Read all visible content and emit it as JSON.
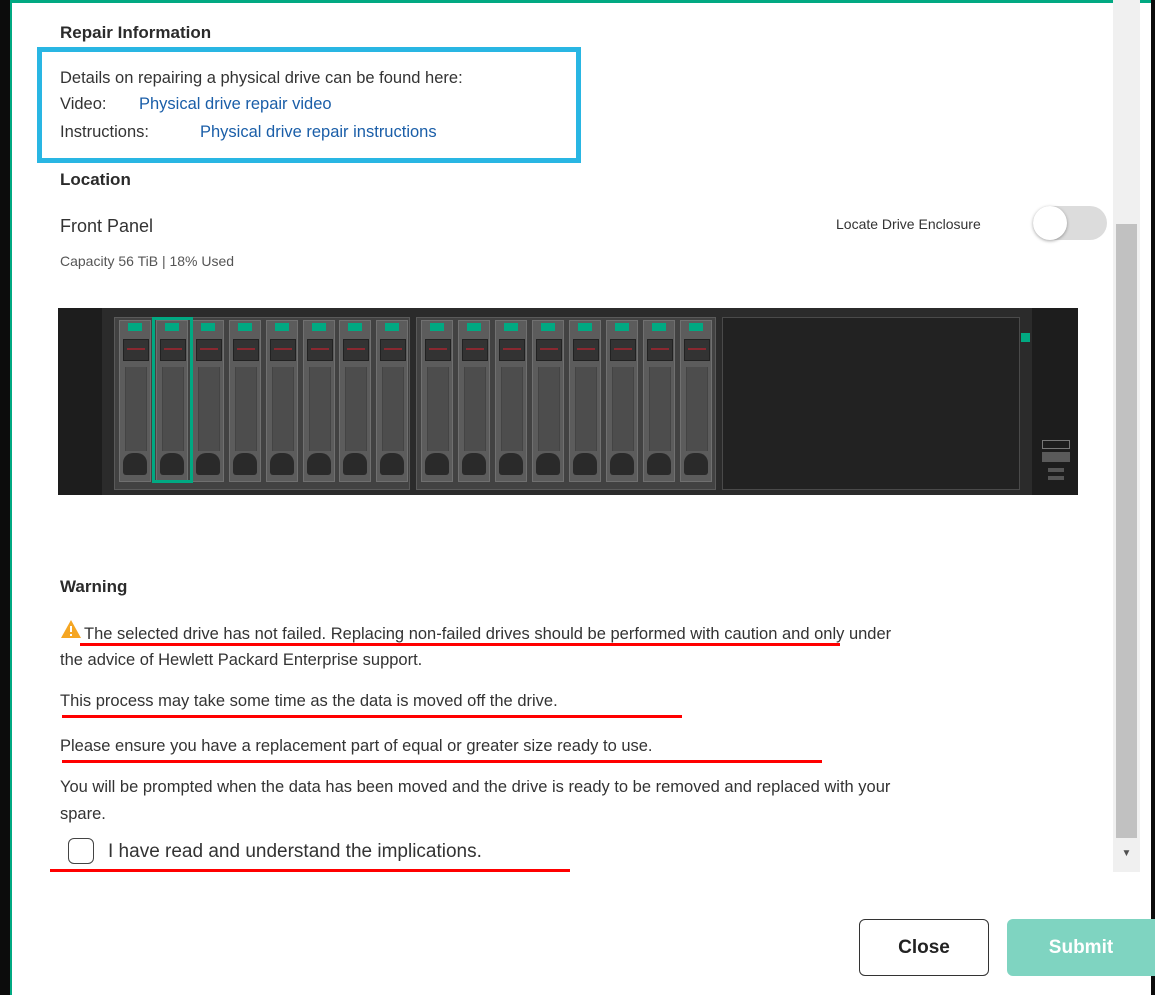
{
  "repair_info": {
    "heading": "Repair Information",
    "details": "Details on repairing a physical drive can be found here:",
    "video_label": "Video:",
    "video_link": "Physical drive repair video",
    "instructions_label": "Instructions:",
    "instructions_link": "Physical drive repair instructions"
  },
  "location": {
    "heading": "Location",
    "panel": "Front Panel",
    "capacity": "Capacity 56 TiB  | 18% Used",
    "locate_label": "Locate Drive Enclosure",
    "locate_toggle_on": false
  },
  "enclosure": {
    "drive_bays": 16,
    "selected_drive": 2,
    "led_color": "#01a982"
  },
  "warning": {
    "heading": "Warning",
    "icon": "warning-triangle-icon",
    "line1a": "The selected drive has not failed. Replacing non-failed drives should be performed with caution and only under",
    "line1b": "the advice of Hewlett Packard Enterprise support.",
    "line2": "This process may take some time as the data is moved off the drive.",
    "line3": "Please ensure you have a replacement part of equal or greater size ready to use.",
    "line4a": "You will be prompted when the data has been moved and the drive is ready to be removed and replaced with your",
    "line4b": "spare.",
    "acknowledge": "I have read and understand the implications.",
    "acknowledge_checked": false
  },
  "footer": {
    "close_label": "Close",
    "submit_label": "Submit"
  },
  "colors": {
    "accent": "#01a982",
    "link": "#1a5ea8",
    "highlight_box": "#29b6e3",
    "annotation_red": "#ff0000",
    "submit_disabled": "#7fd4c1"
  }
}
